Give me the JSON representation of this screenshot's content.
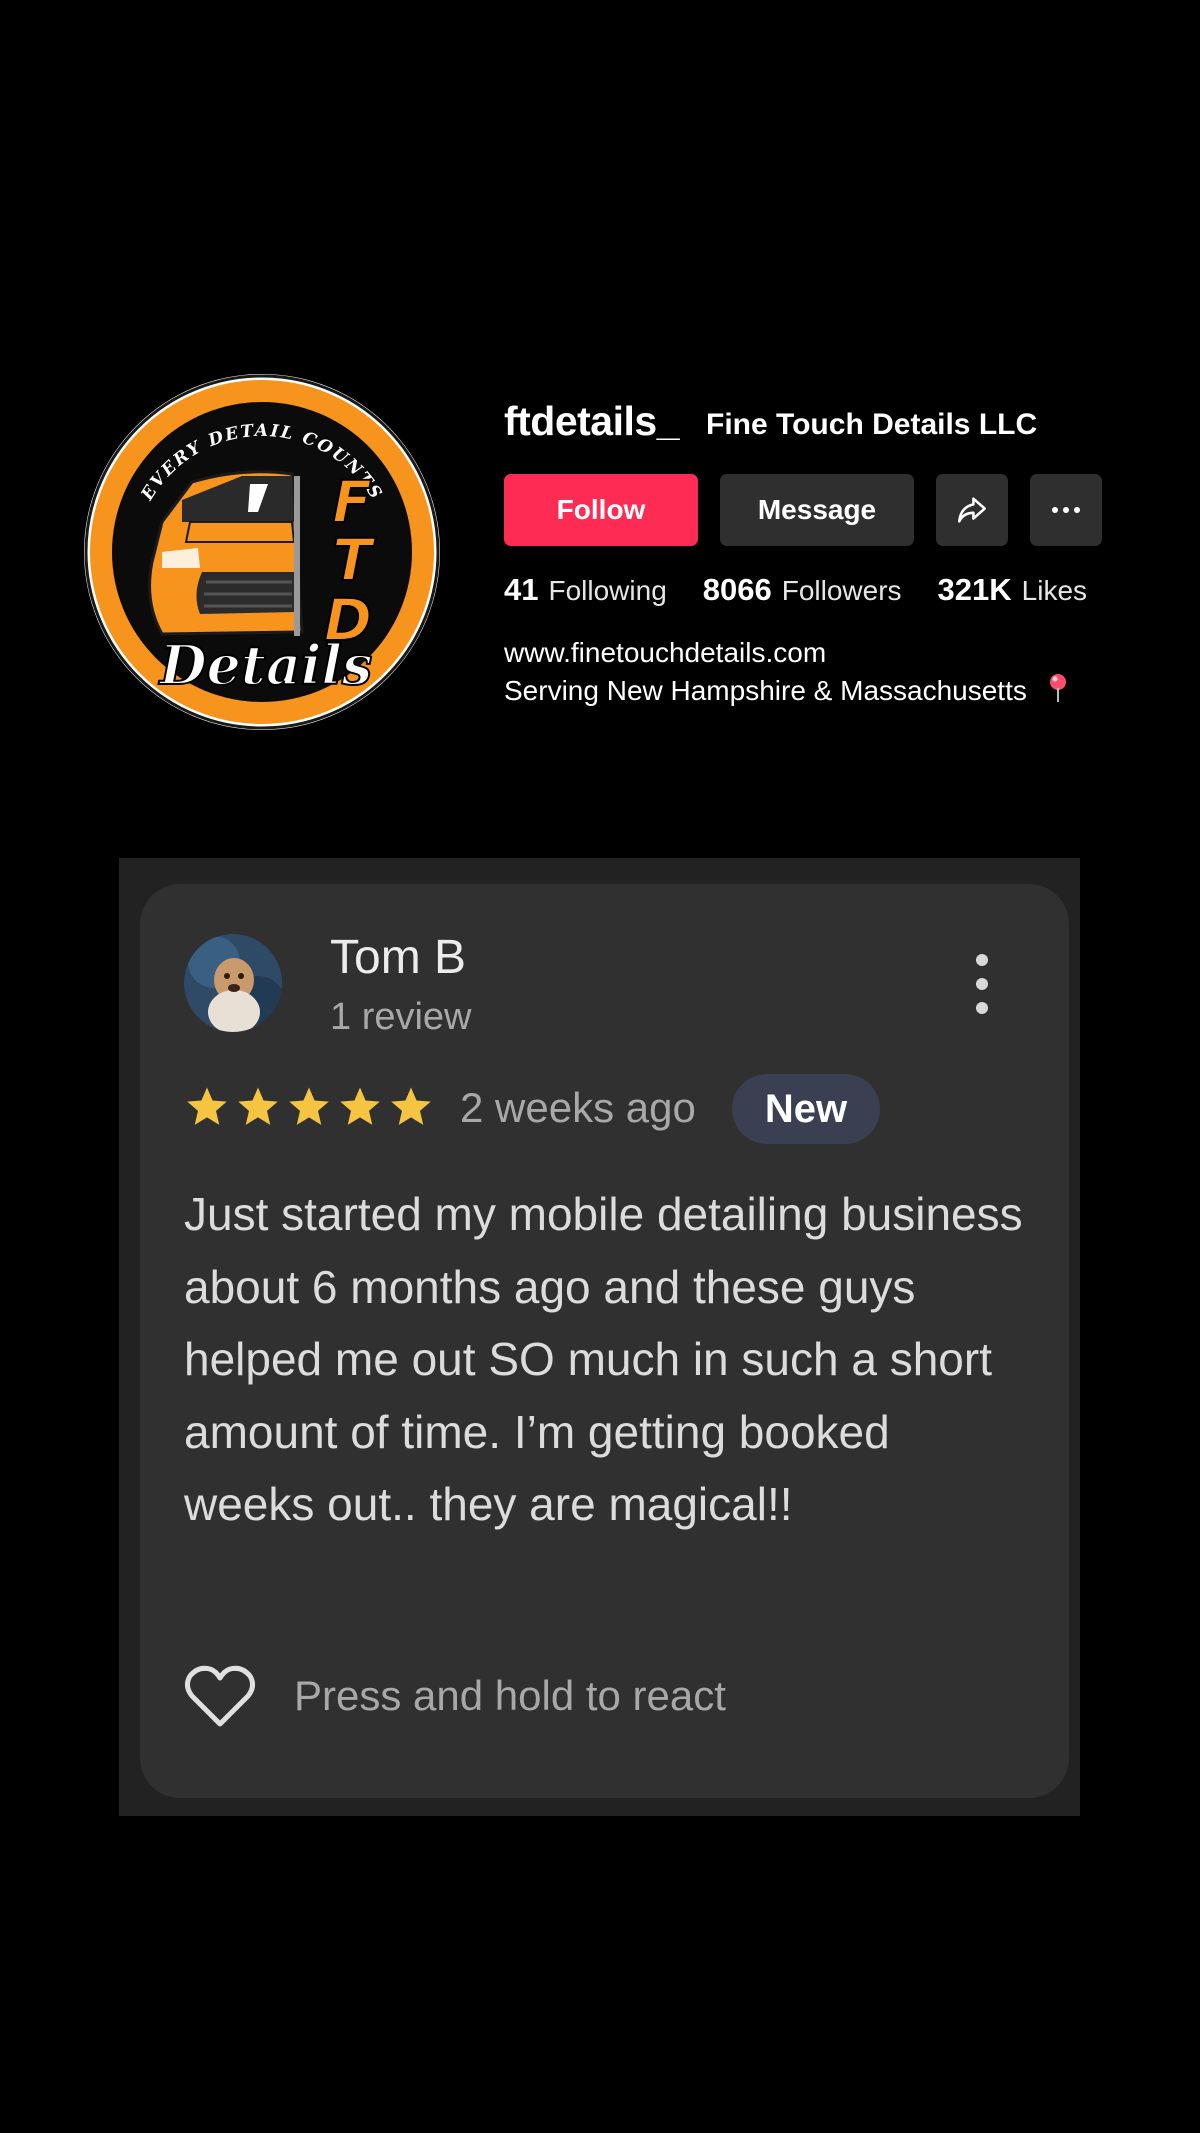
{
  "profile": {
    "logo": {
      "arc_text": "EVERY DETAIL COUNTS",
      "initials": [
        "F",
        "T",
        "D"
      ],
      "script_text": "Details",
      "brand_orange": "#f7941d"
    },
    "username": "ftdetails_",
    "display_name": "Fine Touch Details LLC",
    "buttons": {
      "follow": "Follow",
      "message": "Message",
      "share_icon": "share-arrow-icon",
      "more_icon": "ellipsis-icon"
    },
    "stats": [
      {
        "value": "41",
        "label": "Following"
      },
      {
        "value": "8066",
        "label": "Followers"
      },
      {
        "value": "321K",
        "label": "Likes"
      }
    ],
    "bio": {
      "link": "www.finetouchdetails.com",
      "location_line": "Serving New Hampshire & Massachusetts",
      "location_icon": "map-pin-icon"
    }
  },
  "review": {
    "reviewer_name": "Tom B",
    "reviewer_review_count": "1 review",
    "rating": 5,
    "rating_max": 5,
    "time_ago": "2 weeks ago",
    "badge": "New",
    "text": "Just started my mobile detailing business about 6 months ago and these guys helped me out SO much in such a short amount of time. I’m getting booked weeks out.. they are magical!!",
    "react_hint": "Press and hold to react"
  },
  "colors": {
    "background": "#000000",
    "follow_button": "#fe2c55",
    "secondary_button": "#2f2f2f",
    "card": "#303030",
    "badge": "#3a3f52",
    "star": "#f5c542"
  }
}
